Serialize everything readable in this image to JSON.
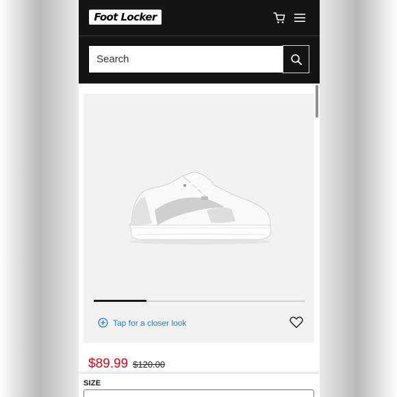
{
  "header": {
    "logo_text": "Foot Locker",
    "icons": {
      "cart": "cart-icon",
      "menu": "menu-icon"
    }
  },
  "search": {
    "placeholder": "Search",
    "button_icon": "search-icon"
  },
  "gallery": {
    "image": "white-sneaker-product-image",
    "progress_fraction": 0.25,
    "zoom_label": "Tap for a closer look",
    "zoom_icon": "plus-circle-icon",
    "wishlist_icon": "heart-icon"
  },
  "pricing": {
    "sale_price": "$89.99",
    "original_price": "$120.00"
  },
  "size": {
    "label": "SIZE"
  },
  "colors": {
    "header_bg": "#141414",
    "sale_red": "#c20e1a",
    "link_blue": "#2b7bc4"
  }
}
